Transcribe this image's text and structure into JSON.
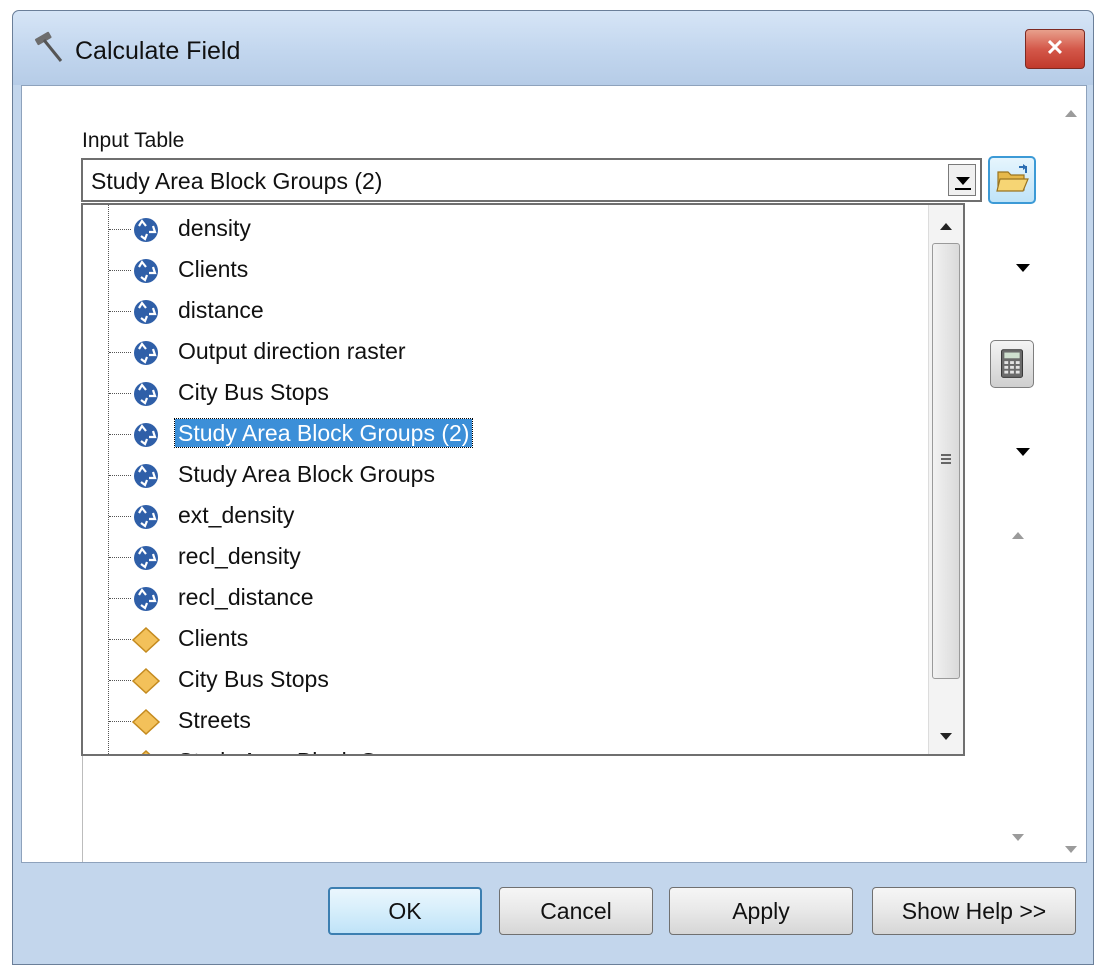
{
  "window": {
    "title": "Calculate Field",
    "close_label": "✕"
  },
  "input_table": {
    "label": "Input Table",
    "selected_value": "Study Area Block Groups (2)"
  },
  "dropdown": {
    "items": [
      {
        "label": "density",
        "icon": "raster-dataset-icon"
      },
      {
        "label": "Clients",
        "icon": "raster-dataset-icon"
      },
      {
        "label": "distance",
        "icon": "raster-dataset-icon"
      },
      {
        "label": "Output direction raster",
        "icon": "raster-dataset-icon"
      },
      {
        "label": "City Bus Stops",
        "icon": "raster-dataset-icon"
      },
      {
        "label": "Study Area Block Groups (2)",
        "icon": "raster-dataset-icon",
        "selected": true
      },
      {
        "label": "Study Area Block Groups",
        "icon": "raster-dataset-icon"
      },
      {
        "label": "ext_density",
        "icon": "raster-dataset-icon"
      },
      {
        "label": "recl_density",
        "icon": "raster-dataset-icon"
      },
      {
        "label": "recl_distance",
        "icon": "raster-dataset-icon"
      },
      {
        "label": "Clients",
        "icon": "feature-layer-icon"
      },
      {
        "label": "City Bus Stops",
        "icon": "feature-layer-icon"
      },
      {
        "label": "Streets",
        "icon": "feature-layer-icon"
      },
      {
        "label": "Study Area Block Groups",
        "icon": "feature-layer-icon"
      }
    ]
  },
  "buttons": {
    "ok": "OK",
    "cancel": "Cancel",
    "apply": "Apply",
    "show_help": "Show Help >>"
  },
  "colors": {
    "selection": "#3c8fd8",
    "titlebar": "#c2d6ee",
    "feature_icon": "#f3c15a",
    "raster_icon": "#2f5fa8"
  }
}
